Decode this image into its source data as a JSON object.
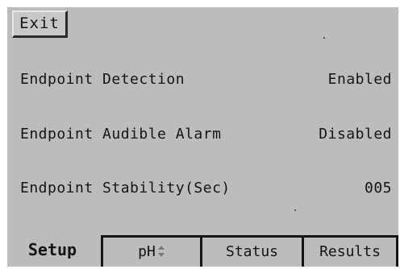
{
  "exit_button": {
    "label": "Exit"
  },
  "settings": [
    {
      "label": "Endpoint Detection",
      "value": "Enabled"
    },
    {
      "label": "Endpoint Audible Alarm",
      "value": "Disabled"
    },
    {
      "label": "Endpoint Stability(Sec)",
      "value": "005"
    }
  ],
  "tabs": [
    {
      "label": "Setup",
      "active": true
    },
    {
      "label": "pH",
      "icon": "up-down-arrows-icon"
    },
    {
      "label": "Status"
    },
    {
      "label": "Results"
    }
  ],
  "colors": {
    "screen_background": "#bcbcbc",
    "text": "#141414"
  }
}
